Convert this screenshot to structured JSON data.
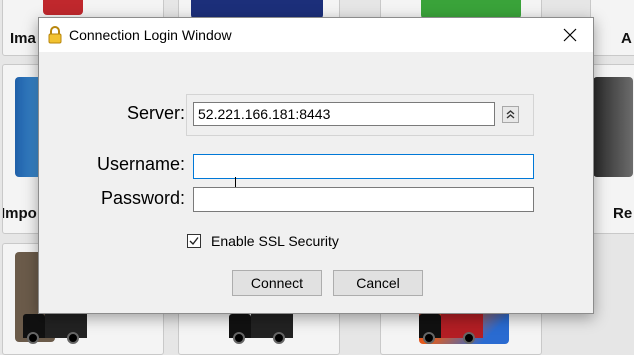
{
  "background": {
    "tiles": [
      {
        "label": "Ima"
      },
      {
        "label": "Impo"
      },
      {
        "label": "A"
      },
      {
        "label": "Re"
      }
    ]
  },
  "dialog": {
    "title": "Connection Login Window",
    "icons": {
      "title": "lock-icon",
      "close": "close-icon",
      "expand": "chevron-up-double-icon",
      "check": "checkmark-icon"
    },
    "server": {
      "label": "Server:",
      "value": "52.221.166.181:8443"
    },
    "username": {
      "label": "Username:",
      "value": ""
    },
    "password": {
      "label": "Password:",
      "value": ""
    },
    "ssl": {
      "label": "Enable SSL Security",
      "checked": true
    },
    "buttons": {
      "connect": "Connect",
      "cancel": "Cancel"
    },
    "colors": {
      "focus_border": "#0078d7",
      "window_bg": "#f0f0f0",
      "titlebar_bg": "#ffffff"
    }
  }
}
